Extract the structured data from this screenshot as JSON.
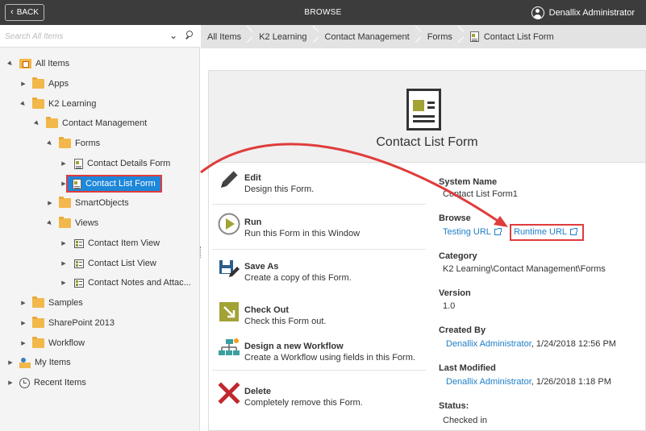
{
  "topbar": {
    "back_label": "BACK",
    "title": "BROWSE",
    "user_name": "Denallix Administrator"
  },
  "search": {
    "placeholder": "Search All Items"
  },
  "tree": {
    "all_items": "All Items",
    "apps": "Apps",
    "k2_learning": "K2 Learning",
    "contact_management": "Contact Management",
    "forms": "Forms",
    "contact_details_form": "Contact Details Form",
    "contact_list_form": "Contact List Form",
    "smartobjects": "SmartObjects",
    "views": "Views",
    "contact_item_view": "Contact Item View",
    "contact_list_view": "Contact List View",
    "contact_notes_view": "Contact Notes and Attac...",
    "samples": "Samples",
    "sharepoint_2013": "SharePoint 2013",
    "workflow": "Workflow",
    "my_items": "My Items",
    "recent_items": "Recent Items"
  },
  "breadcrumb": [
    "All Items",
    "K2 Learning",
    "Contact Management",
    "Forms",
    "Contact List Form"
  ],
  "card": {
    "title": "Contact List Form"
  },
  "actions": [
    {
      "title": "Edit",
      "desc": "Design this Form."
    },
    {
      "title": "Run",
      "desc": "Run this Form in this Window"
    },
    {
      "title": "Save As",
      "desc": "Create a copy of this Form."
    },
    {
      "title": "Check Out",
      "desc": "Check this Form out."
    },
    {
      "title": "Design a new Workflow",
      "desc": "Create a Workflow using fields in this Form."
    },
    {
      "title": "Delete",
      "desc": "Completely remove this Form."
    }
  ],
  "details": {
    "system_name_label": "System Name",
    "system_name": "Contact List Form1",
    "browse_label": "Browse",
    "testing_url": "Testing URL",
    "runtime_url": "Runtime URL",
    "category_label": "Category",
    "category": "K2 Learning\\Contact Management\\Forms",
    "version_label": "Version",
    "version": "1.0",
    "created_by_label": "Created By",
    "created_by": "Denallix Administrator",
    "created_on": ", 1/24/2018 12:56 PM",
    "last_modified_label": "Last Modified",
    "modified_by": "Denallix Administrator",
    "modified_on": ", 1/26/2018 1:18 PM",
    "status_label": "Status:",
    "status": "Checked in"
  },
  "colors": {
    "topbar": "#3c3c3c",
    "selection": "#1e87d9",
    "highlight": "#e03c3c",
    "link": "#1e7fc8",
    "folder": "#f2b84b"
  }
}
